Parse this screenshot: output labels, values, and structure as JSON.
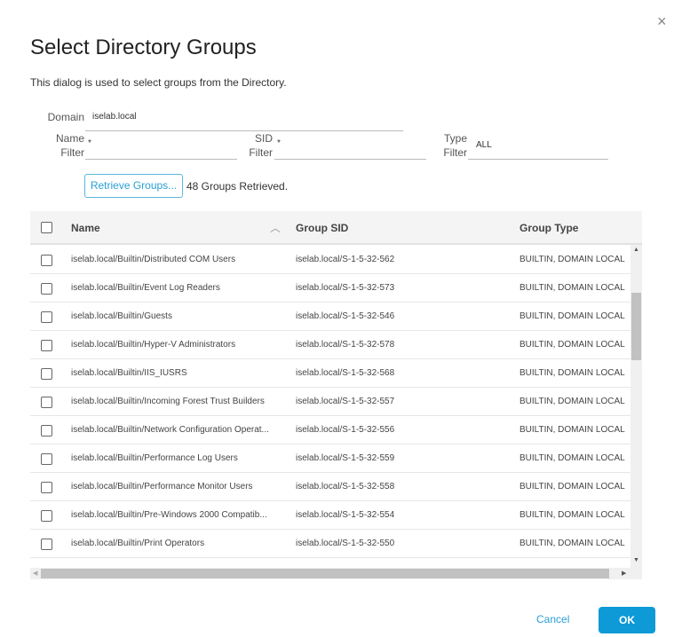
{
  "dialog": {
    "title": "Select Directory Groups",
    "description": "This dialog is used to select groups from the Directory.",
    "close_icon": "×"
  },
  "form": {
    "domain_label": "Domain",
    "domain_value": "iselab.local",
    "name_filter_label_1": "Name",
    "name_filter_label_2": "Filter",
    "name_filter_value": "*",
    "sid_filter_label_1": "SID",
    "sid_filter_label_2": "Filter",
    "sid_filter_value": "*",
    "type_filter_label_1": "Type",
    "type_filter_label_2": "Filter",
    "type_filter_value": "ALL",
    "retrieve_label": "Retrieve Groups...",
    "status": "48 Groups Retrieved."
  },
  "table": {
    "columns": [
      "Name",
      "Group SID",
      "Group Type"
    ],
    "rows": [
      [
        "iselab.local/Builtin/Distributed COM Users",
        "iselab.local/S-1-5-32-562",
        "BUILTIN, DOMAIN LOCAL"
      ],
      [
        "iselab.local/Builtin/Event Log Readers",
        "iselab.local/S-1-5-32-573",
        "BUILTIN, DOMAIN LOCAL"
      ],
      [
        "iselab.local/Builtin/Guests",
        "iselab.local/S-1-5-32-546",
        "BUILTIN, DOMAIN LOCAL"
      ],
      [
        "iselab.local/Builtin/Hyper-V Administrators",
        "iselab.local/S-1-5-32-578",
        "BUILTIN, DOMAIN LOCAL"
      ],
      [
        "iselab.local/Builtin/IIS_IUSRS",
        "iselab.local/S-1-5-32-568",
        "BUILTIN, DOMAIN LOCAL"
      ],
      [
        "iselab.local/Builtin/Incoming Forest Trust Builders",
        "iselab.local/S-1-5-32-557",
        "BUILTIN, DOMAIN LOCAL"
      ],
      [
        "iselab.local/Builtin/Network Configuration Operat...",
        "iselab.local/S-1-5-32-556",
        "BUILTIN, DOMAIN LOCAL"
      ],
      [
        "iselab.local/Builtin/Performance Log Users",
        "iselab.local/S-1-5-32-559",
        "BUILTIN, DOMAIN LOCAL"
      ],
      [
        "iselab.local/Builtin/Performance Monitor Users",
        "iselab.local/S-1-5-32-558",
        "BUILTIN, DOMAIN LOCAL"
      ],
      [
        "iselab.local/Builtin/Pre-Windows 2000 Compatib...",
        "iselab.local/S-1-5-32-554",
        "BUILTIN, DOMAIN LOCAL"
      ],
      [
        "iselab.local/Builtin/Print Operators",
        "iselab.local/S-1-5-32-550",
        "BUILTIN, DOMAIN LOCAL"
      ]
    ]
  },
  "footer": {
    "cancel_label": "Cancel",
    "ok_label": "OK"
  },
  "colors": {
    "accent": "#0d9ad6"
  }
}
